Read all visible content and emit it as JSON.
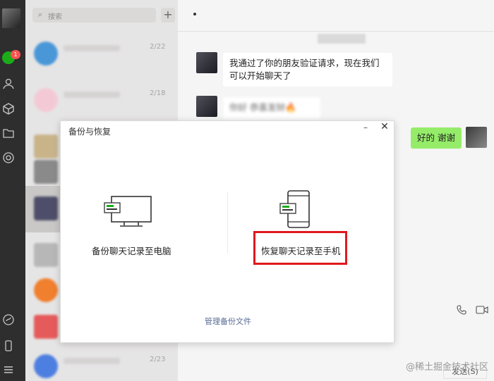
{
  "sidebar": {
    "icons": [
      "avatar",
      "chat-icon",
      "contacts-icon",
      "favorites-icon",
      "folder-icon",
      "moments-icon",
      "mini-program-icon",
      "phone-icon",
      "menu-icon"
    ],
    "chat_badge": "1"
  },
  "chat_list": {
    "search_placeholder": "搜索",
    "add_button": "+",
    "items": [
      {
        "time": "2/22",
        "avatar_color": "#4a97d8"
      },
      {
        "time": "2/18",
        "avatar_color": "#f3c9d5"
      },
      {
        "time": "",
        "avatar_color": "#c9b48a"
      },
      {
        "time": "",
        "avatar_color": "#8a8a8a"
      },
      {
        "time": "",
        "avatar_color": "#4e4e6a"
      },
      {
        "time": "",
        "avatar_color": "#b7b7b7"
      },
      {
        "time": "",
        "avatar_color": "#f07f2e"
      },
      {
        "time": "",
        "avatar_color": "#e55a5a"
      },
      {
        "time": "2/23",
        "avatar_color": "#4d7fe0"
      }
    ]
  },
  "chat": {
    "messages": [
      {
        "from": "other",
        "text": "我通过了你的朋友验证请求，现在我们可以开始聊天了"
      },
      {
        "from": "other",
        "text": "你好 恭喜发财🔥"
      },
      {
        "from": "me",
        "text": "好的 谢谢"
      }
    ],
    "send_label": "发送(S)",
    "watermark": "@稀土掘金技术社区"
  },
  "dialog": {
    "title": "备份与恢复",
    "option_backup": "备份聊天记录至电脑",
    "option_restore": "恢复聊天记录至手机",
    "manage_link": "管理备份文件"
  },
  "colors": {
    "wechat_green": "#1aad19",
    "bubble_green": "#95ec69",
    "highlight_red": "#e0191e",
    "link_blue": "#576b95"
  }
}
